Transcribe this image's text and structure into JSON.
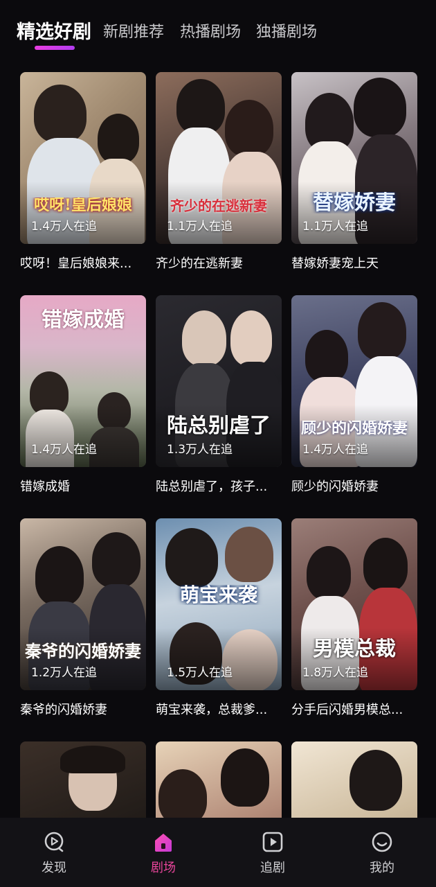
{
  "tabs": [
    {
      "label": "精选好剧",
      "active": true
    },
    {
      "label": "新剧推荐",
      "active": false
    },
    {
      "label": "热播剧场",
      "active": false
    },
    {
      "label": "独播剧场",
      "active": false
    }
  ],
  "cards": [
    {
      "title": "哎呀！皇后娘娘来...",
      "views": "1.4万人在追",
      "poster_text": "哎呀!皇后娘娘"
    },
    {
      "title": "齐少的在逃新妻",
      "views": "1.1万人在追",
      "poster_text": "齐少的在逃新妻"
    },
    {
      "title": "替嫁娇妻宠上天",
      "views": "1.1万人在追",
      "poster_text": "替嫁娇妻"
    },
    {
      "title": "错嫁成婚",
      "views": "1.4万人在追",
      "poster_text": "错嫁成婚"
    },
    {
      "title": "陆总别虐了，孩子...",
      "views": "1.3万人在追",
      "poster_text": "陆总别虐了"
    },
    {
      "title": "顾少的闪婚娇妻",
      "views": "1.4万人在追",
      "poster_text": "顾少的闪婚娇妻"
    },
    {
      "title": "秦爷的闪婚娇妻",
      "views": "1.2万人在追",
      "poster_text": "秦爷的闪婚娇妻"
    },
    {
      "title": "萌宝来袭，总裁爹...",
      "views": "1.5万人在追",
      "poster_text": "萌宝来袭"
    },
    {
      "title": "分手后闪婚男模总...",
      "views": "1.8万人在追",
      "poster_text": "男模总裁"
    },
    {
      "title": "",
      "views": "",
      "poster_text": ""
    },
    {
      "title": "",
      "views": "",
      "poster_text": ""
    },
    {
      "title": "",
      "views": "",
      "poster_text": ""
    }
  ],
  "bottom_nav": [
    {
      "label": "发现",
      "icon": "discover-icon",
      "active": false
    },
    {
      "label": "剧场",
      "icon": "theater-home-icon",
      "active": true
    },
    {
      "label": "追剧",
      "icon": "play-icon",
      "active": false
    },
    {
      "label": "我的",
      "icon": "profile-icon",
      "active": false
    }
  ],
  "colors": {
    "background": "#0b0a0d",
    "accent": "#e9459b",
    "tab_indicator": "#d23ce8",
    "nav_background": "#131216"
  }
}
